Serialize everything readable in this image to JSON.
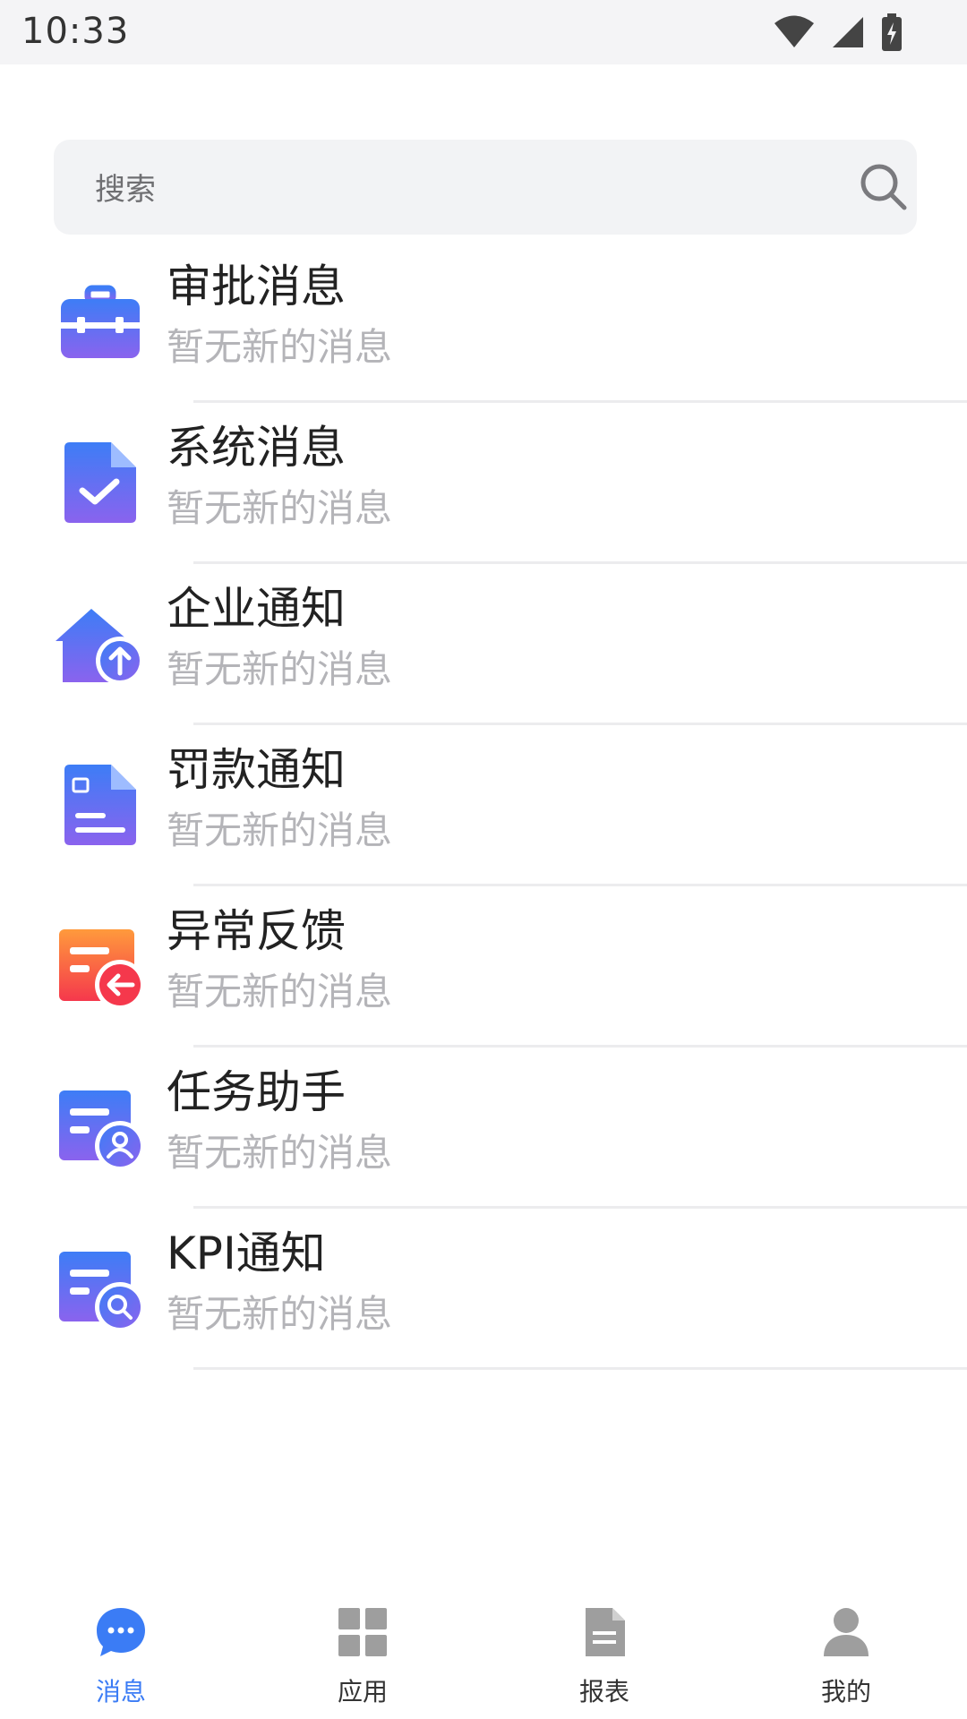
{
  "status_bar": {
    "time": "10:33",
    "icons": [
      "wifi-icon",
      "signal-icon",
      "battery-charging-icon"
    ]
  },
  "search": {
    "placeholder": "搜索",
    "icon": "search-icon"
  },
  "messages": [
    {
      "title": "审批消息",
      "subtitle": "暂无新的消息",
      "icon": "briefcase-icon"
    },
    {
      "title": "系统消息",
      "subtitle": "暂无新的消息",
      "icon": "document-check-icon"
    },
    {
      "title": "企业通知",
      "subtitle": "暂无新的消息",
      "icon": "house-upload-icon"
    },
    {
      "title": "罚款通知",
      "subtitle": "暂无新的消息",
      "icon": "fine-document-icon"
    },
    {
      "title": "异常反馈",
      "subtitle": "暂无新的消息",
      "icon": "feedback-return-icon"
    },
    {
      "title": "任务助手",
      "subtitle": "暂无新的消息",
      "icon": "task-user-icon"
    },
    {
      "title": "KPI通知",
      "subtitle": "暂无新的消息",
      "icon": "kpi-search-icon"
    }
  ],
  "tabs": [
    {
      "label": "消息",
      "icon": "chat-bubble-icon",
      "active": true
    },
    {
      "label": "应用",
      "icon": "grid-icon",
      "active": false
    },
    {
      "label": "报表",
      "icon": "report-document-icon",
      "active": false
    },
    {
      "label": "我的",
      "icon": "user-icon",
      "active": false
    }
  ],
  "colors": {
    "accent": "#3b7cf5",
    "icon_gradient_start": "#3d7df6",
    "icon_gradient_end": "#8a63ee",
    "warning_start": "#ff9a3c",
    "warning_end": "#f5384c",
    "title_text": "#222222",
    "subtitle_text": "#b4b4b8",
    "tab_inactive_icon": "#9e9e9e"
  }
}
